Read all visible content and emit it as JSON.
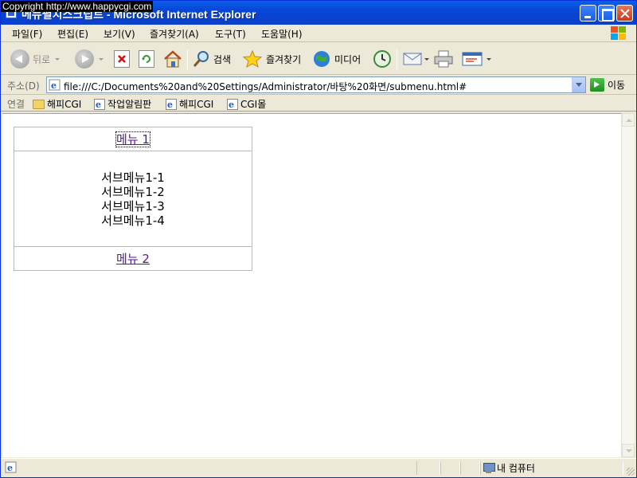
{
  "overlay": {
    "copyright": "Copyright  http://www.happycgi.com"
  },
  "window": {
    "title": "메뉴펼치스크립트 - Microsoft Internet Explorer"
  },
  "menubar": {
    "items": [
      "파일(F)",
      "편집(E)",
      "보기(V)",
      "즐겨찾기(A)",
      "도구(T)",
      "도움말(H)"
    ]
  },
  "toolbar": {
    "back_label": "뒤로",
    "search_label": "검색",
    "favorites_label": "즐겨찾기",
    "media_label": "미디어"
  },
  "address": {
    "label": "주소(D)",
    "url": "file:///C:/Documents%20and%20Settings/Administrator/바탕%20화면/submenu.html#",
    "go_label": "이동"
  },
  "links": {
    "label": "연결",
    "items": [
      "해피CGI",
      "작업알림판",
      "해피CGI",
      "CGI몰"
    ]
  },
  "page": {
    "menu1": "메뉴 1",
    "submenu": [
      "서브메뉴1-1",
      "서브메뉴1-2",
      "서브메뉴1-3",
      "서브메뉴1-4"
    ],
    "menu2": "메뉴 2"
  },
  "status": {
    "zone": "내 컴퓨터"
  },
  "colors": {
    "titlebar": "#0846d6",
    "link_visited": "#551a8b",
    "chrome": "#ece9d8"
  }
}
